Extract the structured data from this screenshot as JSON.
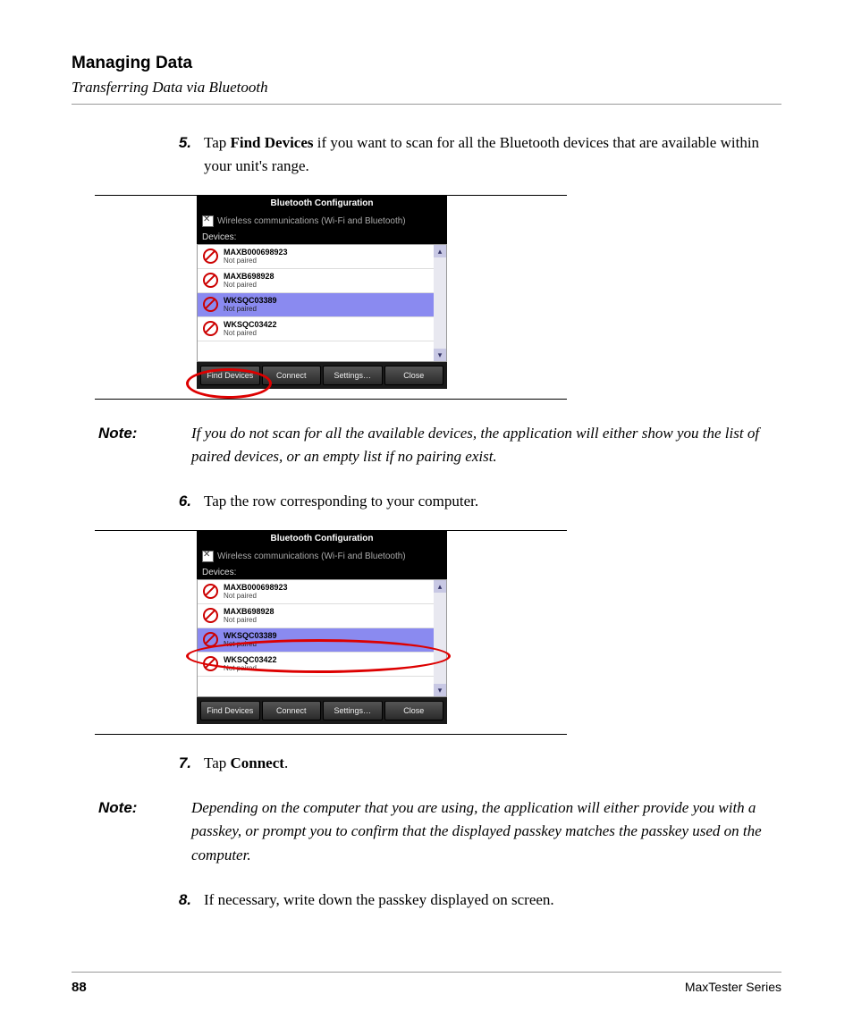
{
  "header": {
    "chapter": "Managing Data",
    "section": "Transferring Data via Bluetooth"
  },
  "steps": {
    "s5": {
      "num": "5.",
      "pre": "Tap ",
      "bold": "Find Devices",
      "post": " if you want to scan for all the Bluetooth devices that are available within your unit's range."
    },
    "s6": {
      "num": "6.",
      "text": "Tap the row corresponding to your computer."
    },
    "s7": {
      "num": "7.",
      "pre": "Tap ",
      "bold": "Connect",
      "post": "."
    },
    "s8": {
      "num": "8.",
      "text": "If necessary, write down the passkey displayed on screen."
    }
  },
  "notes": {
    "label": "Note:",
    "n1": "If you do not scan for all the available devices, the application will either show you the list of paired devices, or an empty list if no pairing exist.",
    "n2": "Depending on the computer that you are using, the application will either provide you with a passkey, or prompt you to confirm that the displayed passkey matches the passkey used on the computer."
  },
  "app": {
    "title": "Bluetooth Configuration",
    "wireless": "Wireless communications (Wi-Fi and Bluetooth)",
    "devices_label": "Devices:",
    "items": [
      {
        "name": "MAXB000698923",
        "status": "Not paired"
      },
      {
        "name": "MAXB698928",
        "status": "Not paired"
      },
      {
        "name": "WKSQC03389",
        "status": "Not paired"
      },
      {
        "name": "WKSQC03422",
        "status": "Not paired"
      }
    ],
    "buttons": {
      "find": "Find Devices",
      "connect": "Connect",
      "settings": "Settings…",
      "close": "Close"
    }
  },
  "footer": {
    "page": "88",
    "series": "MaxTester Series"
  }
}
